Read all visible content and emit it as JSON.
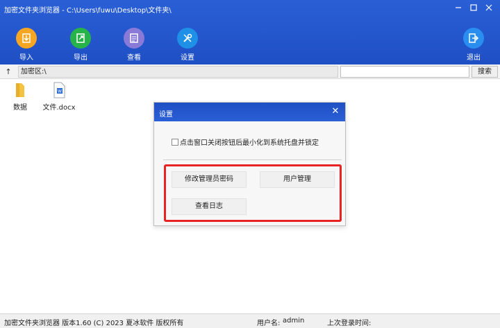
{
  "window": {
    "title": "加密文件夹浏览器 - C:\\Users\\fuwu\\Desktop\\文件夹\\"
  },
  "toolbar": {
    "import": "导入",
    "export": "导出",
    "view": "查看",
    "settings": "设置",
    "exit": "退出"
  },
  "address": {
    "up": "↑",
    "path": "加密区:\\",
    "search_value": "",
    "search_button": "搜索"
  },
  "files": [
    {
      "name": "数据",
      "icon": "folder-icon"
    },
    {
      "name": "文件.docx",
      "icon": "word-document-icon"
    }
  ],
  "dialog": {
    "title": "设置",
    "close": "✕",
    "checkbox_label": "点击窗口关闭按钮后最小化到系统托盘并锁定",
    "change_password": "修改管理员密码",
    "user_management": "用户管理",
    "view_log": "查看日志"
  },
  "status_bar": {
    "app_info": "加密文件夹浏览器  版本1.60 (C) 2023 夏冰软件 版权所有",
    "user_label": "用户名:",
    "user_value": "admin",
    "last_login_label": "上次登录时间:",
    "last_login_value": ""
  },
  "colors": {
    "header_blue": "#2a5fd6",
    "import_orange": "#f5a623",
    "export_green": "#27b34a",
    "view_purple": "#8a7ad8",
    "settings_blue": "#1e90e8",
    "exit_blue": "#2a8ef0",
    "highlight_red": "#e62222"
  }
}
